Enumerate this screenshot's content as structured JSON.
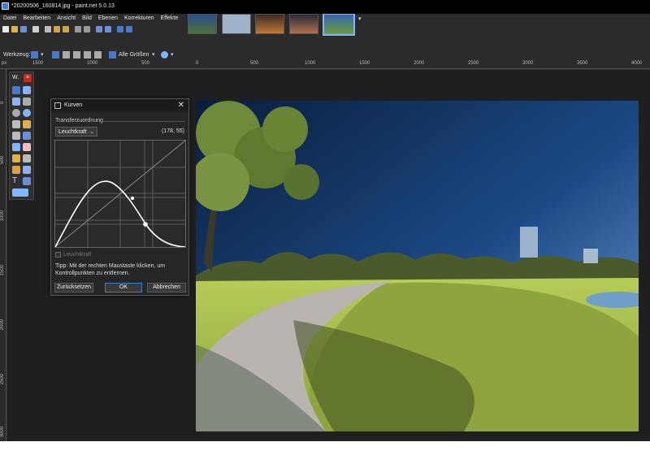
{
  "window": {
    "title": "*20200506_160814.jpg - paint.net 5.0.13"
  },
  "menu": {
    "items": [
      "Datei",
      "Bearbeiten",
      "Ansicht",
      "Bild",
      "Ebenen",
      "Korrekturen",
      "Effekte"
    ]
  },
  "options": {
    "tool_label": "Werkzeug:",
    "size_label": "Alle Größen"
  },
  "ruler": {
    "unit": "px",
    "h_ticks": [
      "1500",
      "1000",
      "500",
      "0",
      "500",
      "1000",
      "1500",
      "2000",
      "2500",
      "3000",
      "3500",
      "4000"
    ],
    "v_ticks": [
      "0",
      "500",
      "1000",
      "1500",
      "2000",
      "2500",
      "3000"
    ]
  },
  "tools_panel": {
    "title": "W.",
    "close": "×"
  },
  "curves_dialog": {
    "title": "Kurven",
    "close": "✕",
    "section": "Transferzuordnung",
    "mode": "Leuchtkraft",
    "coords": "(178, 55)",
    "checkbox_label": "Leuchtkraft",
    "tip": "Tipp: Mit der rechten Maustaste klicken, um Kontrollpunkten zu entfernen.",
    "reset_button": "Zurücksetzen",
    "ok_button": "OK",
    "cancel_button": "Abbrechen"
  },
  "colors": {
    "accent": "#3a7fd0",
    "close_red": "#c42b1c",
    "dialog_bg": "#262626"
  }
}
